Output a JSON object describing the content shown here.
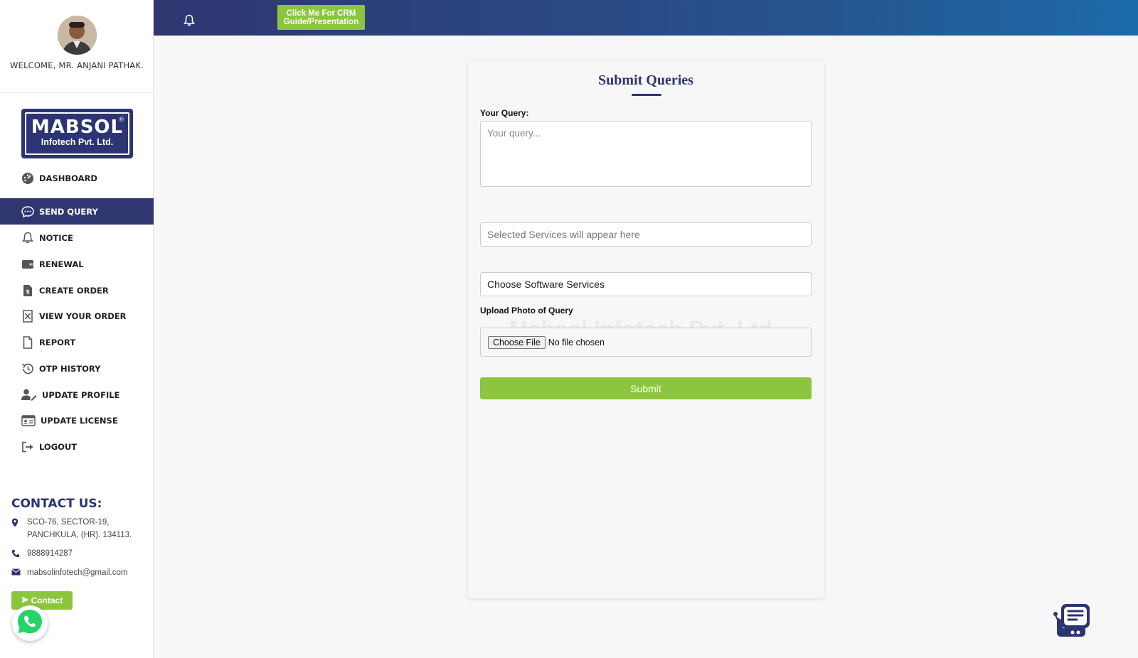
{
  "sidebar": {
    "welcome": "WELCOME, MR. ANJANI PATHAK.",
    "logo": {
      "main": "MABSOL",
      "sub": "Infotech Pvt. Ltd."
    },
    "nav": [
      {
        "label": "DASHBOARD",
        "icon": "dashboard-icon"
      },
      {
        "label": "SEND QUERY",
        "icon": "chat-icon",
        "active": true
      },
      {
        "label": "NOTICE",
        "icon": "bell-icon"
      },
      {
        "label": "RENEWAL",
        "icon": "wallet-icon"
      },
      {
        "label": "CREATE ORDER",
        "icon": "invoice-icon"
      },
      {
        "label": "VIEW YOUR ORDER",
        "icon": "document-x-icon"
      },
      {
        "label": "REPORT",
        "icon": "file-icon"
      },
      {
        "label": "OTP HISTORY",
        "icon": "history-icon"
      },
      {
        "label": "UPDATE PROFILE",
        "icon": "user-edit-icon"
      },
      {
        "label": "UPDATE LICENSE",
        "icon": "id-card-icon"
      },
      {
        "label": "LOGOUT",
        "icon": "logout-icon"
      }
    ],
    "contact": {
      "title": "CONTACT US:",
      "address_line1": "SCO-76, SECTOR-19,",
      "address_line2": "PANCHKULA, (HR). 134113.",
      "phone": "9888914287",
      "email": "mabsolinfotech@gmail.com",
      "button": "Contact"
    }
  },
  "header": {
    "crm_button_line1": "Click Me For CRM",
    "crm_button_line2": "Guide/Presentation"
  },
  "form": {
    "title": "Submit Queries",
    "query_label": "Your Query:",
    "query_placeholder": "Your query...",
    "services_placeholder": "Selected Services will appear here",
    "software_select": "Choose Software Services",
    "upload_label": "Upload Photo of Query",
    "file_button": "Choose File",
    "file_status": "No file chosen",
    "watermark": "Mabsol Infotech Pvt. Ltd",
    "submit": "Submit"
  },
  "colors": {
    "primary": "#2d3473",
    "accent_green": "#8cc63f"
  }
}
